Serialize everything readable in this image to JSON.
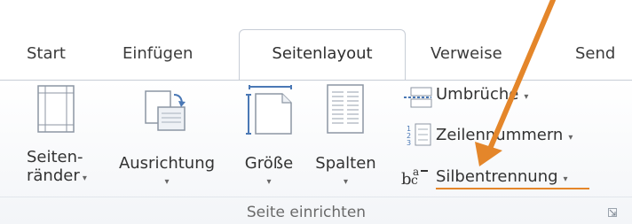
{
  "tabs": [
    {
      "label": "Start"
    },
    {
      "label": "Einfügen"
    },
    {
      "label": "Seitenlayout"
    },
    {
      "label": "Verweise"
    },
    {
      "label": "Send"
    }
  ],
  "buttons": {
    "seitenraender": {
      "line1": "Seiten-",
      "line2": "ränder"
    },
    "ausrichtung": {
      "label": "Ausrichtung"
    },
    "groesse": {
      "label": "Größe"
    },
    "spalten": {
      "label": "Spalten"
    }
  },
  "small_buttons": [
    {
      "label": "Umbrüche"
    },
    {
      "label": "Zeilennummern"
    },
    {
      "label": "Silbentrennung"
    }
  ],
  "group": {
    "label": "Seite einrichten"
  },
  "icons": {
    "seitenraender": "page-margins-icon",
    "ausrichtung": "orientation-icon",
    "groesse": "page-size-icon",
    "spalten": "columns-icon",
    "umbrueche": "breaks-icon",
    "zeilennummern": "line-numbers-icon",
    "silbentrennung": "hyphenation-icon",
    "launcher": "dialog-launcher-icon",
    "annotation": "orange-arrow"
  },
  "colors": {
    "accent_arrow": "#e4862a"
  }
}
